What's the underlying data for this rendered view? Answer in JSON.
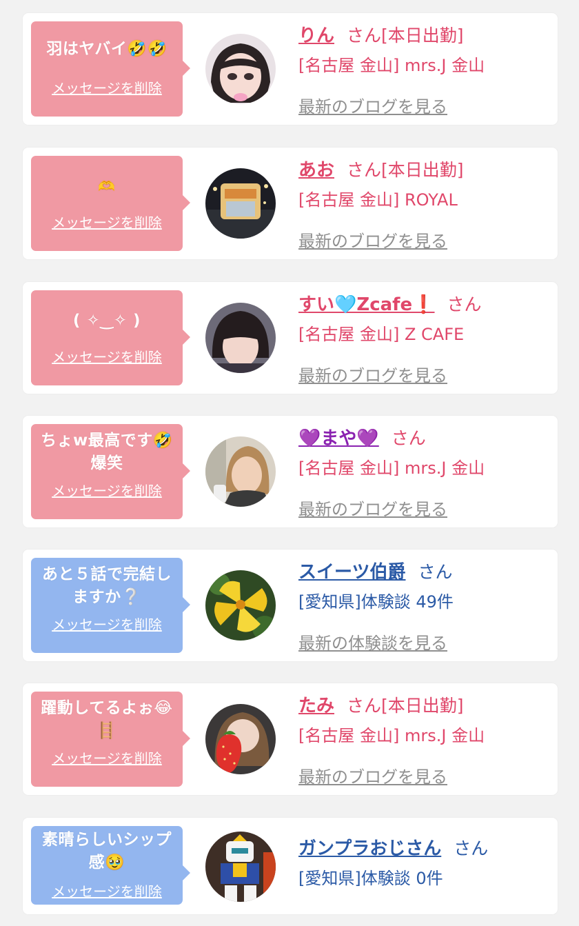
{
  "colors": {
    "bubble_pink": "#f099a3",
    "bubble_blue": "#93b6ef",
    "name_pink": "#e0476a",
    "name_blue": "#2b5aa6",
    "link_gray": "#8f8f8f"
  },
  "cards": [
    {
      "type": "girl",
      "message": "羽はヤバイ🤣🤣",
      "delete_label": "メッセージを削除",
      "name": "りん",
      "suffix": "さん[本日出勤]",
      "shop": "[名古屋 金山] mrs.J 金山",
      "link": "最新のブログを見る"
    },
    {
      "type": "girl",
      "message": "🫶",
      "delete_label": "メッセージを削除",
      "name": "あお",
      "suffix": "さん[本日出勤]",
      "shop": "[名古屋 金山] ROYAL",
      "link": "最新のブログを見る"
    },
    {
      "type": "girl",
      "message": "( ✧‿✧ )",
      "delete_label": "メッセージを削除",
      "name": "すい🩵Zcafe❗️",
      "suffix": "さん",
      "shop": "[名古屋 金山] Z CAFE",
      "link": "最新のブログを見る"
    },
    {
      "type": "girl",
      "message": "ちょw最高です🤣\n爆笑",
      "delete_label": "メッセージを削除",
      "name": "💜まや💜",
      "suffix": "さん",
      "shop": "[名古屋 金山] mrs.J 金山",
      "link": "最新のブログを見る"
    },
    {
      "type": "user",
      "message": "あと５話で完結し\nますか❔",
      "delete_label": "メッセージを削除",
      "name": "スイーツ伯爵",
      "suffix": "さん",
      "shop": "[愛知県]体験談 49件",
      "link": "最新の体験談を見る"
    },
    {
      "type": "girl",
      "message": "躍動してるよぉ😂\n🪜",
      "delete_label": "メッセージを削除",
      "name": "たみ",
      "suffix": "さん[本日出勤]",
      "shop": "[名古屋 金山] mrs.J 金山",
      "link": "最新のブログを見る"
    },
    {
      "type": "user",
      "message": "素晴らしいシップ\n感🥹",
      "delete_label": "メッセージを削除",
      "name": "ガンプラおじさん",
      "suffix": "さん",
      "shop": "[愛知県]体験談 0件",
      "link": ""
    }
  ]
}
